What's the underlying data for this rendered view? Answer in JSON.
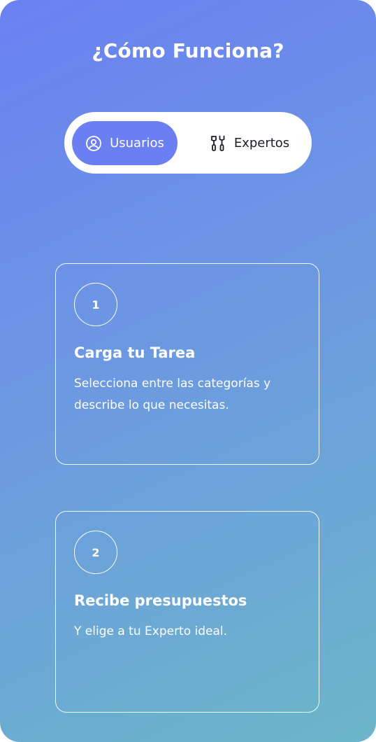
{
  "header": {
    "title": "¿Cómo Funciona?"
  },
  "toggle": {
    "options": [
      {
        "label": "Usuarios",
        "icon": "user-circle-icon",
        "selected": true
      },
      {
        "label": "Expertos",
        "icon": "tools-icon",
        "selected": false
      }
    ]
  },
  "steps": [
    {
      "number": "1",
      "title": "Carga tu Tarea",
      "description": "Selecciona entre las categorías y describe lo que necesitas."
    },
    {
      "number": "2",
      "title": "Recibe presupuestos",
      "description": "Y elige a tu Experto ideal."
    }
  ],
  "colors": {
    "gradient_start": "#6a80f3",
    "gradient_end": "#6bb6c9",
    "active_segment": "#6b7ff2",
    "text_light": "#ffffff",
    "text_dark": "#1d1d2b"
  }
}
